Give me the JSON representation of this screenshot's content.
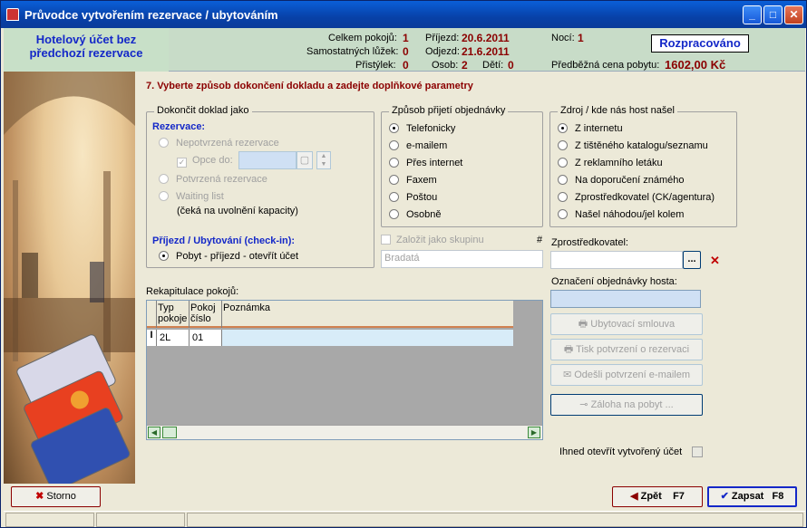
{
  "window": {
    "title": "Průvodce vytvořením rezervace / ubytováním"
  },
  "header": {
    "left_line1": "Hotelový účet bez",
    "left_line2": "předchozí rezervace",
    "celkem_pokoju_label": "Celkem pokojů:",
    "celkem_pokoju": "1",
    "samostatnych_luzek_label": "Samostatných lůžek:",
    "samostatnych_luzek": "0",
    "pristylek_label": "Přistýlek:",
    "pristylek": "0",
    "prijezd_label": "Příjezd:",
    "prijezd": "20.6.2011",
    "odjezd_label": "Odjezd:",
    "odjezd": "21.6.2011",
    "osob_label": "Osob:",
    "osob": "2",
    "deti_label": "Dětí:",
    "deti": "0",
    "noci_label": "Nocí:",
    "noci": "1",
    "status": "Rozpracováno",
    "cena_label": "Předběžná cena pobytu:",
    "cena": "1602,00 Kč"
  },
  "step": {
    "title": "7.  Vyberte způsob dokončení dokladu a zadejte doplňkové parametry"
  },
  "dokoncit": {
    "title": "Dokončit doklad jako",
    "rezervace_label": "Rezervace:",
    "nepotvrzena": "Nepotvrzená rezervace",
    "opce_label": "Opce do:",
    "potvrzena": "Potvrzená rezervace",
    "waiting": "Waiting list",
    "waiting_note": "(čeká na uvolnění kapacity)",
    "prijezd_label": "Příjezd / Ubytování  (check-in):",
    "pobyt": "Pobyt - příjezd - otevřít účet"
  },
  "zpusob": {
    "title": "Způsob přijetí objednávky",
    "options": [
      "Telefonicky",
      "e-mailem",
      "Přes internet",
      "Faxem",
      "Poštou",
      "Osobně"
    ],
    "selected": "Telefonicky"
  },
  "zdroj": {
    "title": "Zdroj / kde nás host našel",
    "options": [
      "Z internetu",
      "Z tištěného katalogu/seznamu",
      "Z reklamního letáku",
      "Na doporučení známého",
      "Zprostředkovatel (CK/agentura)",
      "Našel náhodou/jel kolem"
    ],
    "selected": "Z internetu"
  },
  "skupina": {
    "label": "Založit jako skupinu",
    "hash": "#",
    "name": "Bradatá"
  },
  "zprostredkovatel": {
    "label": "Zprostředkovatel:",
    "ellipsis": "...",
    "clear": "✕"
  },
  "oznaceni": {
    "label": "Označení objednávky hosta:"
  },
  "rekapitulace": {
    "label": "Rekapitulace pokojů:",
    "columns": [
      "Typ pokoje",
      "Pokoj číslo",
      "Poznámka"
    ],
    "col_typ_1": "Typ",
    "col_typ_2": "pokoje",
    "col_pokoj_1": "Pokoj",
    "col_pokoj_2": "číslo",
    "rows": [
      {
        "typ": "2L",
        "pokoj": "01",
        "poznamka": ""
      }
    ]
  },
  "actions": {
    "smlouva": "Ubytovací smlouva",
    "tisk": "Tisk potvrzení o rezervaci",
    "email": "Odešli potvrzení e-mailem",
    "zaloha": "Záloha na pobyt ..."
  },
  "ihned": {
    "label": "Ihned otevřít vytvořený účet"
  },
  "footer": {
    "storno": "Storno",
    "zpet": "Zpět",
    "zpet_key": "F7",
    "zapsat": "Zapsat",
    "zapsat_key": "F8"
  }
}
